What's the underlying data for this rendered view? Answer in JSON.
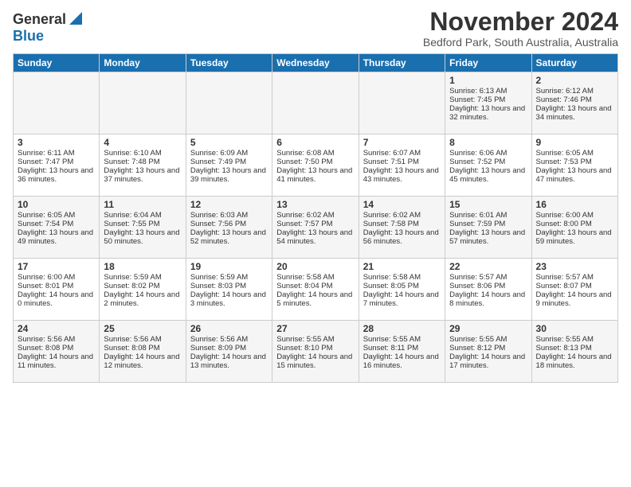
{
  "header": {
    "logo_line1": "General",
    "logo_line2": "Blue",
    "title": "November 2024",
    "subtitle": "Bedford Park, South Australia, Australia"
  },
  "days_of_week": [
    "Sunday",
    "Monday",
    "Tuesday",
    "Wednesday",
    "Thursday",
    "Friday",
    "Saturday"
  ],
  "weeks": [
    [
      {
        "day": "",
        "info": ""
      },
      {
        "day": "",
        "info": ""
      },
      {
        "day": "",
        "info": ""
      },
      {
        "day": "",
        "info": ""
      },
      {
        "day": "",
        "info": ""
      },
      {
        "day": "1",
        "info": "Sunrise: 6:13 AM\nSunset: 7:45 PM\nDaylight: 13 hours and 32 minutes."
      },
      {
        "day": "2",
        "info": "Sunrise: 6:12 AM\nSunset: 7:46 PM\nDaylight: 13 hours and 34 minutes."
      }
    ],
    [
      {
        "day": "3",
        "info": "Sunrise: 6:11 AM\nSunset: 7:47 PM\nDaylight: 13 hours and 36 minutes."
      },
      {
        "day": "4",
        "info": "Sunrise: 6:10 AM\nSunset: 7:48 PM\nDaylight: 13 hours and 37 minutes."
      },
      {
        "day": "5",
        "info": "Sunrise: 6:09 AM\nSunset: 7:49 PM\nDaylight: 13 hours and 39 minutes."
      },
      {
        "day": "6",
        "info": "Sunrise: 6:08 AM\nSunset: 7:50 PM\nDaylight: 13 hours and 41 minutes."
      },
      {
        "day": "7",
        "info": "Sunrise: 6:07 AM\nSunset: 7:51 PM\nDaylight: 13 hours and 43 minutes."
      },
      {
        "day": "8",
        "info": "Sunrise: 6:06 AM\nSunset: 7:52 PM\nDaylight: 13 hours and 45 minutes."
      },
      {
        "day": "9",
        "info": "Sunrise: 6:05 AM\nSunset: 7:53 PM\nDaylight: 13 hours and 47 minutes."
      }
    ],
    [
      {
        "day": "10",
        "info": "Sunrise: 6:05 AM\nSunset: 7:54 PM\nDaylight: 13 hours and 49 minutes."
      },
      {
        "day": "11",
        "info": "Sunrise: 6:04 AM\nSunset: 7:55 PM\nDaylight: 13 hours and 50 minutes."
      },
      {
        "day": "12",
        "info": "Sunrise: 6:03 AM\nSunset: 7:56 PM\nDaylight: 13 hours and 52 minutes."
      },
      {
        "day": "13",
        "info": "Sunrise: 6:02 AM\nSunset: 7:57 PM\nDaylight: 13 hours and 54 minutes."
      },
      {
        "day": "14",
        "info": "Sunrise: 6:02 AM\nSunset: 7:58 PM\nDaylight: 13 hours and 56 minutes."
      },
      {
        "day": "15",
        "info": "Sunrise: 6:01 AM\nSunset: 7:59 PM\nDaylight: 13 hours and 57 minutes."
      },
      {
        "day": "16",
        "info": "Sunrise: 6:00 AM\nSunset: 8:00 PM\nDaylight: 13 hours and 59 minutes."
      }
    ],
    [
      {
        "day": "17",
        "info": "Sunrise: 6:00 AM\nSunset: 8:01 PM\nDaylight: 14 hours and 0 minutes."
      },
      {
        "day": "18",
        "info": "Sunrise: 5:59 AM\nSunset: 8:02 PM\nDaylight: 14 hours and 2 minutes."
      },
      {
        "day": "19",
        "info": "Sunrise: 5:59 AM\nSunset: 8:03 PM\nDaylight: 14 hours and 3 minutes."
      },
      {
        "day": "20",
        "info": "Sunrise: 5:58 AM\nSunset: 8:04 PM\nDaylight: 14 hours and 5 minutes."
      },
      {
        "day": "21",
        "info": "Sunrise: 5:58 AM\nSunset: 8:05 PM\nDaylight: 14 hours and 7 minutes."
      },
      {
        "day": "22",
        "info": "Sunrise: 5:57 AM\nSunset: 8:06 PM\nDaylight: 14 hours and 8 minutes."
      },
      {
        "day": "23",
        "info": "Sunrise: 5:57 AM\nSunset: 8:07 PM\nDaylight: 14 hours and 9 minutes."
      }
    ],
    [
      {
        "day": "24",
        "info": "Sunrise: 5:56 AM\nSunset: 8:08 PM\nDaylight: 14 hours and 11 minutes."
      },
      {
        "day": "25",
        "info": "Sunrise: 5:56 AM\nSunset: 8:08 PM\nDaylight: 14 hours and 12 minutes."
      },
      {
        "day": "26",
        "info": "Sunrise: 5:56 AM\nSunset: 8:09 PM\nDaylight: 14 hours and 13 minutes."
      },
      {
        "day": "27",
        "info": "Sunrise: 5:55 AM\nSunset: 8:10 PM\nDaylight: 14 hours and 15 minutes."
      },
      {
        "day": "28",
        "info": "Sunrise: 5:55 AM\nSunset: 8:11 PM\nDaylight: 14 hours and 16 minutes."
      },
      {
        "day": "29",
        "info": "Sunrise: 5:55 AM\nSunset: 8:12 PM\nDaylight: 14 hours and 17 minutes."
      },
      {
        "day": "30",
        "info": "Sunrise: 5:55 AM\nSunset: 8:13 PM\nDaylight: 14 hours and 18 minutes."
      }
    ]
  ]
}
